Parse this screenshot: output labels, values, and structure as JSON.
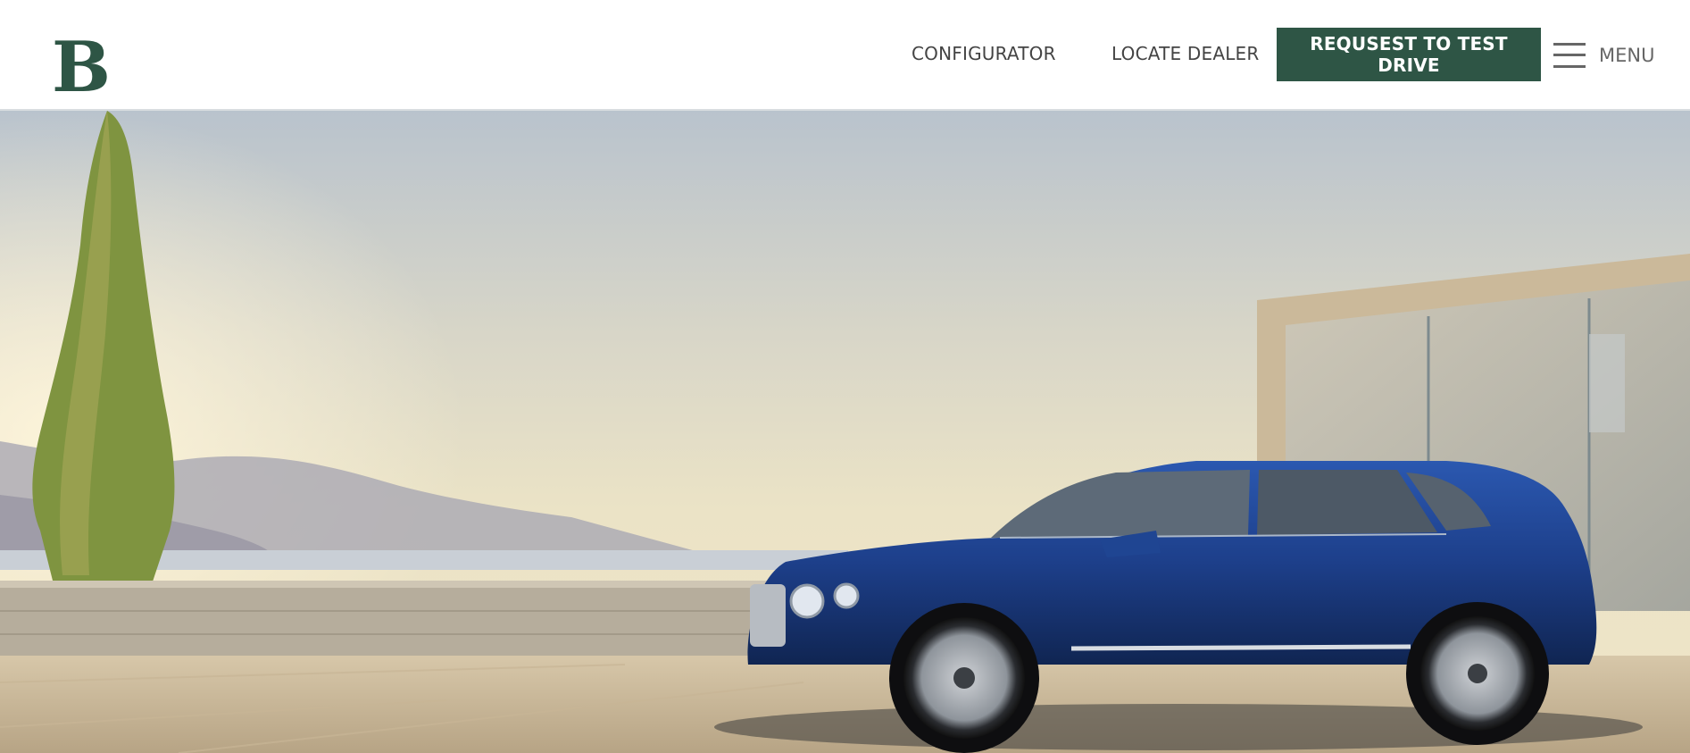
{
  "header": {
    "logo_label": "B",
    "nav": {
      "configurator_label": "CONFIGURATOR",
      "locate_dealer_label": "LOCATE DEALER"
    },
    "cta_label": "REQUSEST TO TEST DRIVE",
    "menu_label": "MENU"
  },
  "hero": {
    "image_alt": "Blue luxury SUV parked on a terrace overlooking the sea beside a glass pavilion"
  },
  "colors": {
    "brand_green": "#2e5545",
    "nav_text": "#444444",
    "car_blue": "#1d3f8a"
  },
  "icons": [
    "bentley-b-logo",
    "hamburger-menu-icon"
  ]
}
